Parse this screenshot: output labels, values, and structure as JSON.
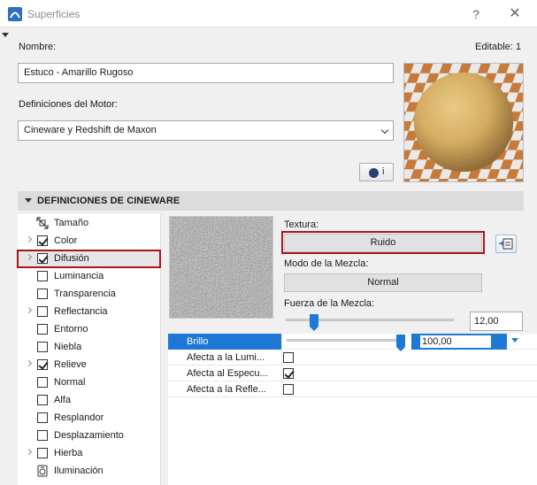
{
  "window": {
    "title": "Superficies",
    "help_label": "?",
    "close_label": "✕"
  },
  "header": {
    "name_label": "Nombre:",
    "name_value": "Estuco - Amarillo Rugoso",
    "editable_label": "Editable: 1",
    "engine_label": "Definiciones del Motor:",
    "engine_value": "Cineware y Redshift de Maxon",
    "info_button_label": "i"
  },
  "section": {
    "title": "DEFINICIONES DE CINEWARE"
  },
  "channels": [
    {
      "label": "Tamaño",
      "icon": "size-icon",
      "expandable": false,
      "checkbox": null
    },
    {
      "label": "Color",
      "expandable": true,
      "checkbox": true
    },
    {
      "label": "Difusión",
      "expandable": true,
      "checkbox": true,
      "selected": true
    },
    {
      "label": "Luminancia",
      "expandable": false,
      "checkbox": false
    },
    {
      "label": "Transparencia",
      "expandable": false,
      "checkbox": false
    },
    {
      "label": "Reflectancia",
      "expandable": true,
      "checkbox": false
    },
    {
      "label": "Entorno",
      "expandable": false,
      "checkbox": false
    },
    {
      "label": "Niebla",
      "expandable": false,
      "checkbox": false
    },
    {
      "label": "Relieve",
      "expandable": true,
      "checkbox": true
    },
    {
      "label": "Normal",
      "expandable": false,
      "checkbox": false
    },
    {
      "label": "Alfa",
      "expandable": false,
      "checkbox": false
    },
    {
      "label": "Resplandor",
      "expandable": false,
      "checkbox": false
    },
    {
      "label": "Desplazamiento",
      "expandable": false,
      "checkbox": false
    },
    {
      "label": "Hierba",
      "expandable": true,
      "checkbox": false
    },
    {
      "label": "Iluminación",
      "icon": "illumination-icon",
      "expandable": false,
      "checkbox": null
    }
  ],
  "diffusion": {
    "texture_label": "Textura:",
    "texture_button": "Ruido",
    "blend_mode_label": "Modo de la Mezcla:",
    "blend_mode_value": "Normal",
    "blend_strength_label": "Fuerza de la Mezcla:",
    "blend_strength_value": "12,00",
    "blend_strength_level": 0.12
  },
  "properties": [
    {
      "label": "Brillo",
      "value": "100,00",
      "level": 1.0,
      "selected": true
    },
    {
      "label": "Afecta a la Lumi...",
      "checked": false
    },
    {
      "label": "Afecta al Especu...",
      "checked": true
    },
    {
      "label": "Afecta a la Refle...",
      "checked": false
    }
  ],
  "colors": {
    "accent": "#1e78d6",
    "highlight_border": "#a8161c",
    "material": "#d9aa55"
  }
}
